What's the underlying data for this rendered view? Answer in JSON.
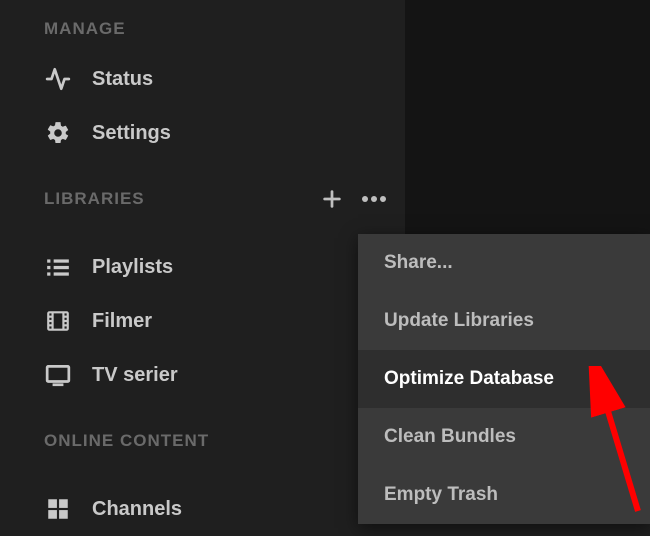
{
  "sections": {
    "manage": "MANAGE",
    "libraries": "LIBRARIES",
    "online": "ONLINE CONTENT"
  },
  "nav": {
    "status": "Status",
    "settings": "Settings",
    "playlists": "Playlists",
    "filmer": "Filmer",
    "tvserier": "TV serier",
    "channels": "Channels"
  },
  "menu": {
    "share": "Share...",
    "update": "Update Libraries",
    "optimize": "Optimize Database",
    "clean": "Clean Bundles",
    "empty": "Empty Trash"
  }
}
